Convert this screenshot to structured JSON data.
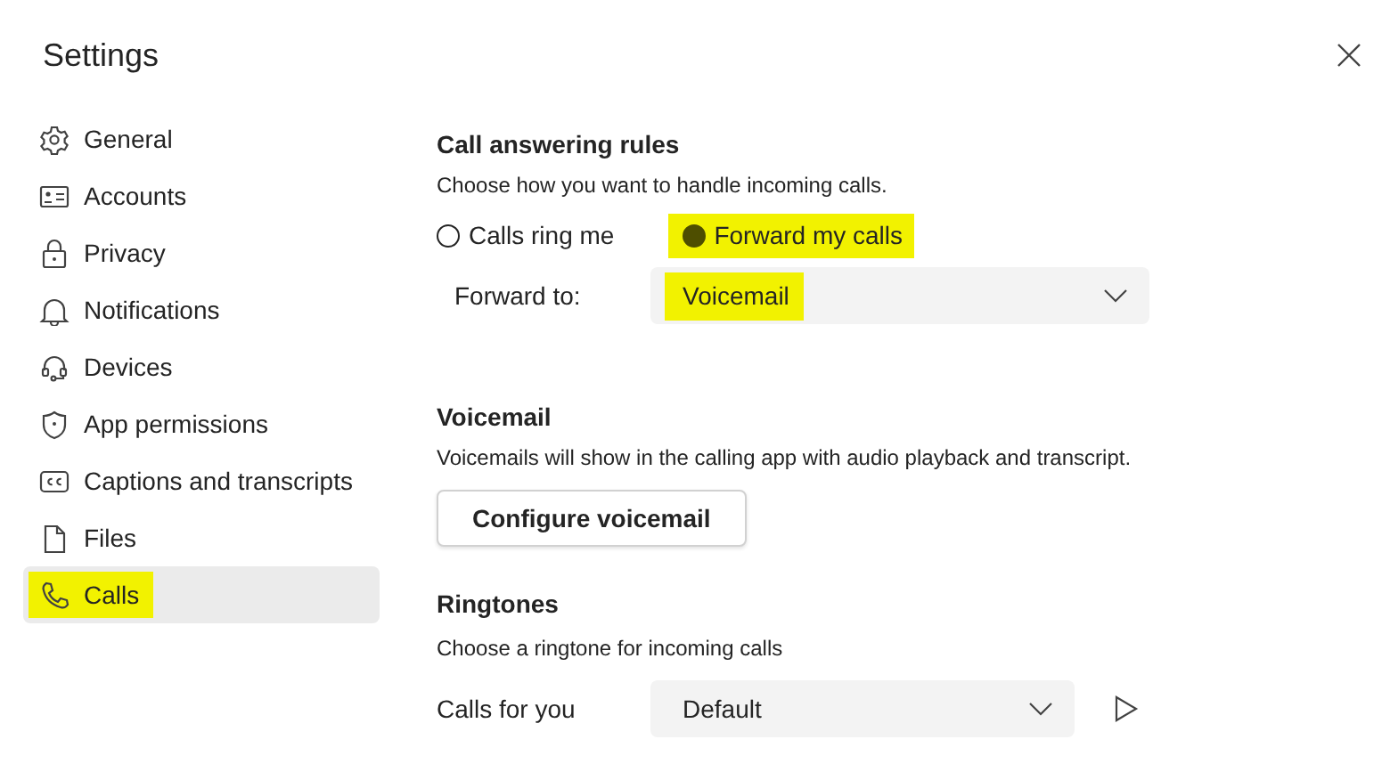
{
  "window": {
    "title": "Settings"
  },
  "sidebar": {
    "items": [
      {
        "label": "General",
        "selected": false,
        "highlighted": false
      },
      {
        "label": "Accounts",
        "selected": false,
        "highlighted": false
      },
      {
        "label": "Privacy",
        "selected": false,
        "highlighted": false
      },
      {
        "label": "Notifications",
        "selected": false,
        "highlighted": false
      },
      {
        "label": "Devices",
        "selected": false,
        "highlighted": false
      },
      {
        "label": "App permissions",
        "selected": false,
        "highlighted": false
      },
      {
        "label": "Captions and transcripts",
        "selected": false,
        "highlighted": false
      },
      {
        "label": "Files",
        "selected": false,
        "highlighted": false
      },
      {
        "label": "Calls",
        "selected": true,
        "highlighted": true
      }
    ]
  },
  "call_answering": {
    "heading": "Call answering rules",
    "description": "Choose how you want to handle incoming calls.",
    "options": [
      {
        "label": "Calls ring me",
        "selected": false,
        "highlighted": false
      },
      {
        "label": "Forward my calls",
        "selected": true,
        "highlighted": true
      }
    ],
    "forward_to": {
      "label": "Forward to:",
      "value": "Voicemail",
      "highlighted": true
    }
  },
  "voicemail": {
    "heading": "Voicemail",
    "description": "Voicemails will show in the calling app with audio playback and transcript.",
    "button": "Configure voicemail"
  },
  "ringtones": {
    "heading": "Ringtones",
    "description": "Choose a ringtone for incoming calls",
    "calls_for_you": {
      "label": "Calls for you",
      "value": "Default"
    }
  }
}
